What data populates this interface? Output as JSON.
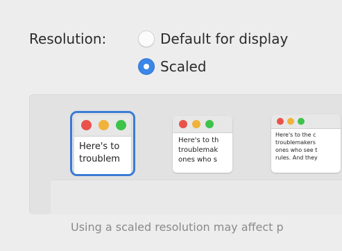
{
  "resolution": {
    "label": "Resolution:",
    "options": [
      {
        "label": "Default for display",
        "selected": false
      },
      {
        "label": "Scaled",
        "selected": true
      }
    ]
  },
  "thumbnails": [
    {
      "text_line1": "Here's to",
      "text_line2": "troublem",
      "selected": true
    },
    {
      "text_line1": "Here's to th",
      "text_line2": "troublemak",
      "text_line3": "ones who s",
      "selected": false
    },
    {
      "text_line1": "Here's to the c",
      "text_line2": "troublemakers",
      "text_line3": "ones who see t",
      "text_line4": "rules. And they",
      "selected": false
    }
  ],
  "note": "Using a scaled resolution may affect p",
  "colors": {
    "accent": "#3b86e6",
    "selection_border": "#3a7bd5"
  }
}
